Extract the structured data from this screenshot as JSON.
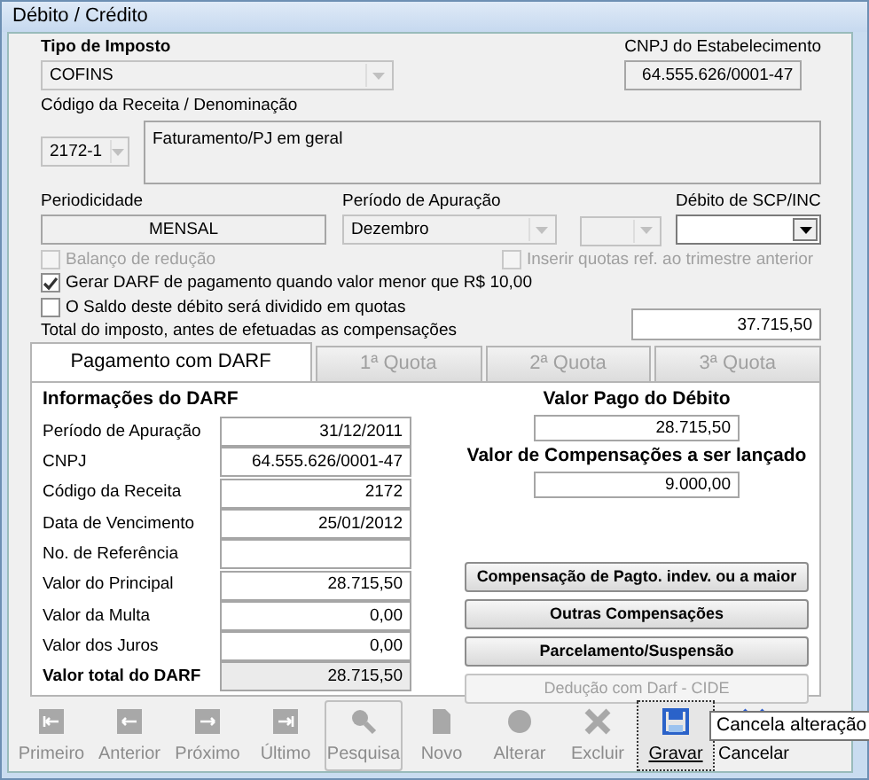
{
  "window": {
    "title": "Débito / Crédito"
  },
  "tipo_imposto": {
    "label": "Tipo de Imposto",
    "value": "COFINS"
  },
  "cnpj_estabelecimento": {
    "label": "CNPJ do Estabelecimento",
    "value": "64.555.626/0001-47"
  },
  "codigo_receita": {
    "label": "Código da Receita / Denominação",
    "code": "2172-1",
    "denomination": "Faturamento/PJ em geral"
  },
  "periodicidade": {
    "label": "Periodicidade",
    "value": "MENSAL"
  },
  "periodo_apuracao": {
    "label": "Período de Apuração",
    "month": "Dezembro"
  },
  "debito_scp": {
    "label": "Débito de SCP/INC"
  },
  "checkboxes": [
    {
      "label": "Balanço de redução",
      "checked": false,
      "disabled": true
    },
    {
      "label": "Inserir quotas ref. ao trimestre anterior",
      "checked": false,
      "disabled": true
    },
    {
      "label": "Gerar DARF de pagamento quando valor menor que R$ 10,00",
      "checked": true,
      "disabled": false
    },
    {
      "label": "O Saldo deste débito será dividido em quotas",
      "checked": false,
      "disabled": false
    }
  ],
  "total": {
    "label": "Total do imposto, antes de efetuadas as compensações",
    "value": "37.715,50"
  },
  "tabs": [
    {
      "label": "Pagamento com DARF",
      "selected": true,
      "disabled": false
    },
    {
      "label": "1ª Quota",
      "selected": false,
      "disabled": true
    },
    {
      "label": "2ª Quota",
      "selected": false,
      "disabled": true
    },
    {
      "label": "3ª Quota",
      "selected": false,
      "disabled": true
    }
  ],
  "darf": {
    "title": "Informações do DARF",
    "rows": [
      {
        "label": "Período de Apuração",
        "value": "31/12/2011",
        "kind": "plain"
      },
      {
        "label": "CNPJ",
        "value": "64.555.626/0001-47",
        "kind": "plain"
      },
      {
        "label": "Código da Receita",
        "value": "2172",
        "kind": "plain"
      },
      {
        "label": "Data de Vencimento",
        "value": "25/01/2012",
        "kind": "plain"
      },
      {
        "label": "No. de Referência",
        "kind": "plain"
      },
      {
        "label": "Valor do Principal",
        "value": "28.715,50",
        "kind": "plain"
      },
      {
        "label": "Valor da Multa",
        "value": "0,00",
        "kind": "plain"
      },
      {
        "label": "Valor dos Juros",
        "value": "0,00",
        "kind": "plain"
      },
      {
        "label": "Valor total do DARF",
        "value": "28.715,50",
        "kind": "total"
      }
    ]
  },
  "valor_pago": {
    "label": "Valor Pago do Débito",
    "value": "28.715,50"
  },
  "valor_compensacoes": {
    "label": "Valor de Compensações a ser lançado",
    "value": "9.000,00"
  },
  "actions": [
    {
      "label": "Compensação de Pagto. indev. ou a maior",
      "disabled": false
    },
    {
      "label": "Outras Compensações",
      "disabled": false
    },
    {
      "label": "Parcelamento/Suspensão",
      "disabled": false
    },
    {
      "label": "Dedução com Darf - CIDE",
      "disabled": true
    }
  ],
  "toolbar": [
    {
      "label": "Primeiro",
      "disabled": true,
      "focused": false
    },
    {
      "label": "Anterior",
      "disabled": true,
      "focused": false
    },
    {
      "label": "Próximo",
      "disabled": true,
      "focused": false
    },
    {
      "label": "Último",
      "disabled": true,
      "focused": false
    },
    {
      "label": "Pesquisa",
      "disabled": true,
      "focused": false
    },
    {
      "label": "Novo",
      "disabled": true,
      "focused": false
    },
    {
      "label": "Alterar",
      "disabled": true,
      "focused": false
    },
    {
      "label": "Excluir",
      "disabled": true,
      "focused": false
    },
    {
      "label": "Gravar",
      "disabled": false,
      "focused": true
    },
    {
      "label": "Cancelar",
      "disabled": false,
      "focused": false
    }
  ],
  "tooltip": "Cancela alteração"
}
